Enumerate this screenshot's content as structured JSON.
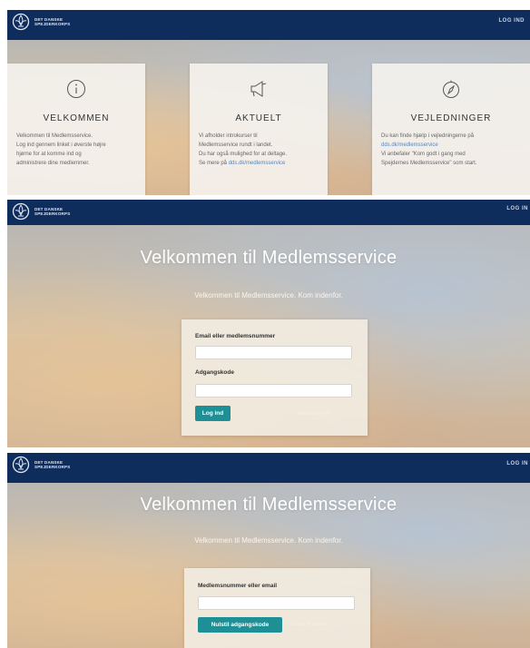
{
  "header": {
    "logo_line1": "DET DANSKE",
    "logo_line2": "SPEJDERKORPS",
    "login_label": "LOG IND",
    "login_label_cropped": "LOG IN"
  },
  "info": {
    "cards": [
      {
        "icon": "info-icon",
        "title": "VELKOMMEN",
        "lines": [
          "Velkommen til Medlemsservice.",
          "Log ind gennem linket i øverste højre",
          "hjørne for at komme ind og",
          "administrere dine medlemmer."
        ]
      },
      {
        "icon": "megaphone-icon",
        "title": "AKTUELT",
        "lines": [
          "Vi afholder introkurser til",
          "Medlemsservice rundt i landet.",
          "Du har også mulighed for at deltage."
        ],
        "link_prefix": "Se mere på ",
        "link": "dds.dk/medlemsservice"
      },
      {
        "icon": "compass-icon",
        "title": "VEJLEDNINGER",
        "line1": "Du kan finde hjælp i vejledningerne på",
        "link": "dds.dk/medlemsservice",
        "lines_after": [
          "Vi anbefaler \"Kom godt i gang med",
          "Spejdernes Medlemsservice\" som start."
        ]
      }
    ]
  },
  "login": {
    "title": "Velkommen til Medlemsservice",
    "subtitle": "Velkommen til Medlemsservice. Kom indenfor.",
    "email_label": "Email eller medlemsnummer",
    "password_label": "Adgangskode",
    "submit_label": "Log ind",
    "reset_link": "Nulstil kodeord"
  },
  "reset": {
    "title": "Velkommen til Medlemsservice",
    "subtitle": "Velkommen til Medlemsservice. Kom indenfor.",
    "field_label": "Medlemsnummer eller email",
    "submit_label": "Nulstil adgangskode",
    "back_link": "Tilbage til log ind"
  },
  "colors": {
    "topbar": "#0f2d5c",
    "button": "#1f8f96",
    "link": "#4f87c9"
  }
}
